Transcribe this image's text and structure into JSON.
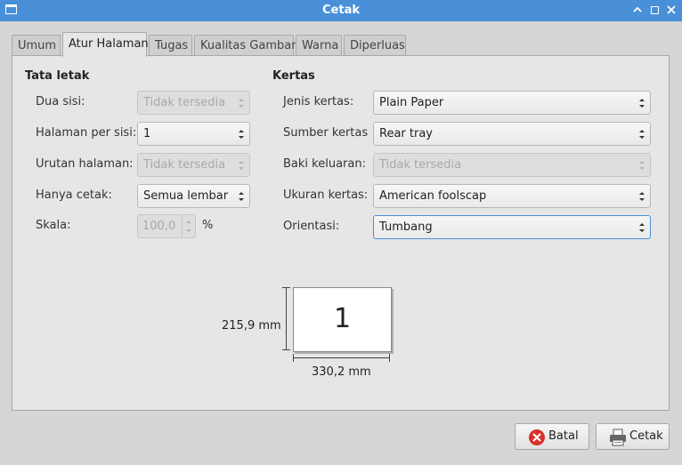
{
  "window": {
    "title": "Cetak"
  },
  "tabs": [
    {
      "label": "Umum",
      "active": false
    },
    {
      "label": "Atur Halaman",
      "active": true
    },
    {
      "label": "Tugas",
      "active": false
    },
    {
      "label": "Kualitas Gambar",
      "active": false
    },
    {
      "label": "Warna",
      "active": false
    },
    {
      "label": "Diperluas",
      "active": false
    }
  ],
  "layout": {
    "title": "Tata letak",
    "two_sided": {
      "label": "Dua sisi:",
      "value": "Tidak tersedia",
      "enabled": false
    },
    "pages_per_side": {
      "label": "Halaman per sisi:",
      "value": "1",
      "enabled": true
    },
    "page_order": {
      "label": "Urutan halaman:",
      "value": "Tidak tersedia",
      "enabled": false
    },
    "only_print": {
      "label": "Hanya cetak:",
      "value": "Semua lembar",
      "enabled": true
    },
    "scale": {
      "label": "Skala:",
      "value": "100,0",
      "unit": "%",
      "enabled": false
    }
  },
  "paper": {
    "title": "Kertas",
    "paper_type": {
      "label": "Jenis kertas:",
      "value": "Plain Paper"
    },
    "paper_source": {
      "label": "Sumber kertas",
      "value": "Rear tray"
    },
    "output_tray": {
      "label": "Baki keluaran:",
      "value": "Tidak tersedia",
      "enabled": false
    },
    "paper_size": {
      "label": "Ukuran kertas:",
      "value": "American foolscap"
    },
    "orientation": {
      "label": "Orientasi:",
      "value": "Tumbang"
    }
  },
  "preview": {
    "page_number": "1",
    "height_label": "215,9 mm",
    "width_label": "330,2 mm"
  },
  "buttons": {
    "cancel": {
      "label": "Batal",
      "icon": "cancel-icon"
    },
    "print": {
      "label": "Cetak",
      "icon": "printer-icon"
    }
  },
  "colors": {
    "titlebar": "#4a90d9",
    "focus": "#4a90d9",
    "cancel_icon": "#d9302c"
  }
}
